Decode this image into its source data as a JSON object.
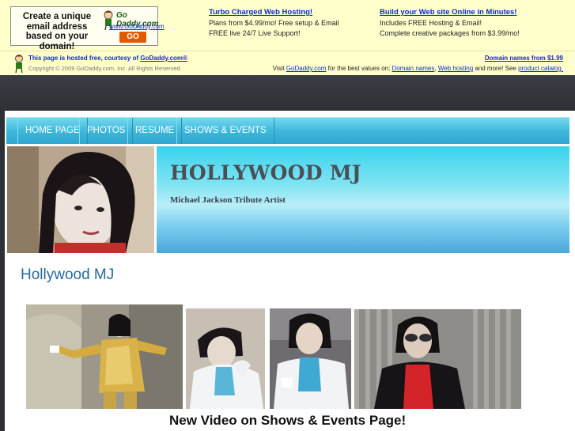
{
  "ad": {
    "banner_text": "Create a unique email address based on your domain!",
    "banner_brand": "Go Daddy.com",
    "banner_url": "www.GoDaddy.com",
    "banner_go": "GO",
    "col1": {
      "heading": "Turbo Charged Web Hosting!",
      "line1": "Plans from $4.99/mo! Free setup & Email",
      "line2": "FREE live 24/7 Live Support!"
    },
    "col2": {
      "heading": "Build your Web site Online in Minutes!",
      "line1": "Includes FREE Hosting & Email!",
      "line2": "Complete creative packages from $3.99/mo!"
    },
    "hosted_prefix": "This page is hosted free, courtesy of ",
    "hosted_link": "GoDaddy.com®",
    "copyright": "Copyright © 2009 GoDaddy.com, Inc. All Rights Reserved.",
    "domain_names_link": "Domain names from $1.99",
    "visit_prefix": "Visit ",
    "visit_link": "GoDaddy.com",
    "visit_middle": " for the best values on: ",
    "visit_domains": "Domain names",
    "visit_comma": ", ",
    "visit_hosting": "Web hosting",
    "visit_more": " and more! See ",
    "visit_catalog": "product catalog."
  },
  "nav": {
    "items": [
      {
        "label": "HOME PAGE"
      },
      {
        "label": "PHOTOS"
      },
      {
        "label": "RESUME"
      },
      {
        "label": "SHOWS & EVENTS"
      }
    ]
  },
  "header": {
    "title": "HOLLYWOOD MJ",
    "subtitle": "Michael Jackson Tribute Artist"
  },
  "main": {
    "heading": "Hollywood MJ",
    "news": "New Video on Shows & Events Page!"
  },
  "colors": {
    "nav_blue": "#3fb8dc",
    "link_blue": "#0a2bd6",
    "heading_blue": "#276a9c",
    "ad_background": "#ffffcc",
    "page_dark": "#2e3035"
  }
}
